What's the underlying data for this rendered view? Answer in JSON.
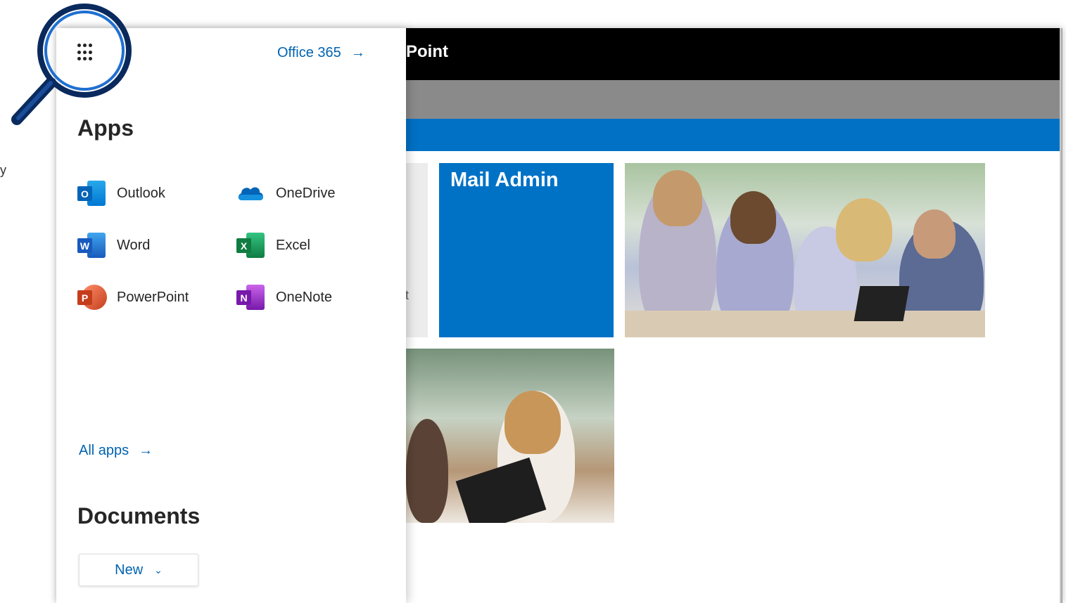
{
  "suite_bar": {
    "title_visible": "Point"
  },
  "launcher": {
    "office365_link": "Office 365",
    "arrow": "→",
    "apps_heading": "Apps",
    "apps": [
      {
        "label": "Outlook",
        "icon": "outlook-icon",
        "letter": "O",
        "color": "#0078d4"
      },
      {
        "label": "OneDrive",
        "icon": "onedrive-icon",
        "letter": "",
        "color": "#0364b8"
      },
      {
        "label": "Word",
        "icon": "word-icon",
        "letter": "W",
        "color": "#185abd"
      },
      {
        "label": "Excel",
        "icon": "excel-icon",
        "letter": "X",
        "color": "#107c41"
      },
      {
        "label": "PowerPoint",
        "icon": "powerpoint-icon",
        "letter": "P",
        "color": "#c43e1c"
      },
      {
        "label": "OneNote",
        "icon": "onenote-icon",
        "letter": "N",
        "color": "#7719aa"
      }
    ],
    "all_apps_link": "All apps",
    "documents_heading": "Documents",
    "new_button": "New"
  },
  "main": {
    "mail_admin_tile": "Mail Admin",
    "partial_tile_text": "t"
  },
  "edge_text": "y",
  "colors": {
    "brand_blue": "#0072c6",
    "link_blue": "#0063b1",
    "magnifier": "#0a2a5e"
  }
}
